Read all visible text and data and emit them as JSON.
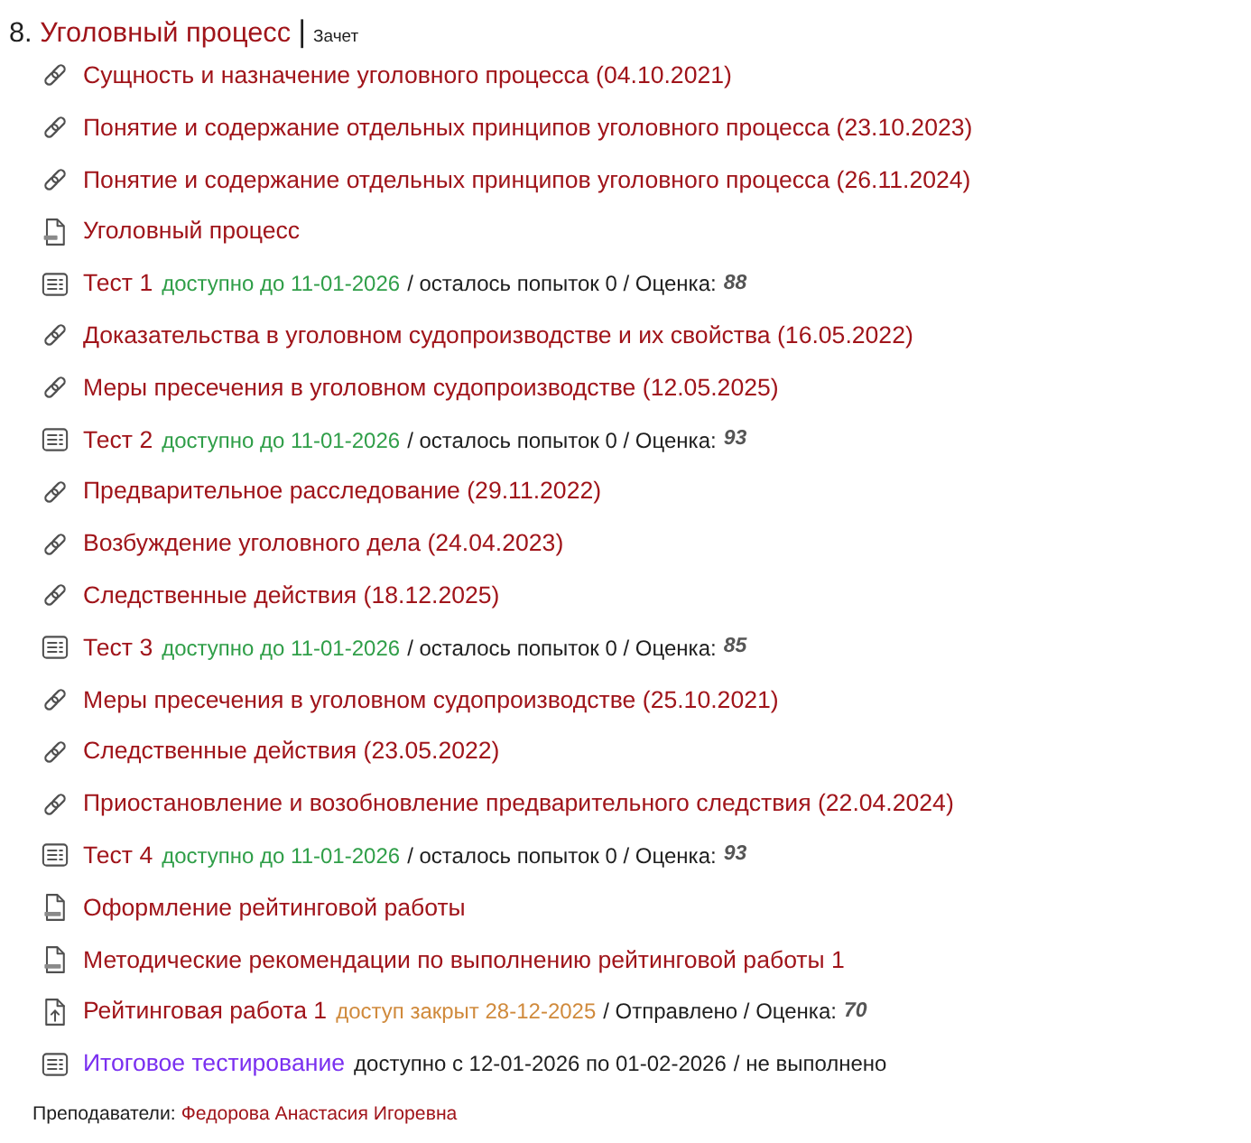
{
  "section": {
    "number": "8.",
    "title": "Уголовный процесс",
    "separator": "|",
    "tag": "Зачет"
  },
  "items": [
    {
      "kind": "link",
      "title": "Сущность и назначение уголовного процесса (04.10.2021)"
    },
    {
      "kind": "link",
      "title": "Понятие и содержание отдельных принципов уголовного процесса (23.10.2023)"
    },
    {
      "kind": "link",
      "title": "Понятие и содержание отдельных принципов уголовного процесса (26.11.2024)"
    },
    {
      "kind": "pdf",
      "title": "Уголовный процесс"
    },
    {
      "kind": "test",
      "title": "Тест 1",
      "availability": {
        "text": "доступно до 11-01-2026",
        "color": "#2f9e48"
      },
      "details": "/ осталось попыток 0 / Оценка:",
      "grade": "88"
    },
    {
      "kind": "link",
      "title": "Доказательства в уголовном судопроизводстве и их свойства (16.05.2022)"
    },
    {
      "kind": "link",
      "title": "Меры пресечения в уголовном судопроизводстве (12.05.2025)"
    },
    {
      "kind": "test",
      "title": "Тест 2",
      "availability": {
        "text": "доступно до 11-01-2026",
        "color": "#2f9e48"
      },
      "details": "/ осталось попыток 0 / Оценка:",
      "grade": "93"
    },
    {
      "kind": "link",
      "title": "Предварительное расследование (29.11.2022)"
    },
    {
      "kind": "link",
      "title": "Возбуждение уголовного дела (24.04.2023)"
    },
    {
      "kind": "link",
      "title": "Следственные действия (18.12.2025)"
    },
    {
      "kind": "test",
      "title": "Тест 3",
      "availability": {
        "text": "доступно до 11-01-2026",
        "color": "#2f9e48"
      },
      "details": "/ осталось попыток 0 / Оценка:",
      "grade": "85"
    },
    {
      "kind": "link",
      "title": "Меры пресечения в уголовном судопроизводстве (25.10.2021)"
    },
    {
      "kind": "link",
      "title": "Следственные действия (23.05.2022)"
    },
    {
      "kind": "link",
      "title": "Приостановление и возобновление предварительного следствия (22.04.2024)"
    },
    {
      "kind": "test",
      "title": "Тест 4",
      "availability": {
        "text": "доступно до 11-01-2026",
        "color": "#2f9e48"
      },
      "details": "/ осталось попыток 0 / Оценка:",
      "grade": "93"
    },
    {
      "kind": "doc",
      "title": "Оформление рейтинговой работы"
    },
    {
      "kind": "doc",
      "title": "Методические рекомендации по выполнению рейтинговой работы 1"
    },
    {
      "kind": "upload",
      "title": "Рейтинговая работа 1",
      "availability": {
        "text": "доступ закрыт 28-12-2025",
        "color": "#d08a3c"
      },
      "details": "/ Отправлено / Оценка:",
      "grade": "70"
    },
    {
      "kind": "final_test",
      "title": "Итоговое тестирование",
      "availability": {
        "text": "доступно с 12-01-2026 по 01-02-2026",
        "color": "#1e1e1e"
      },
      "details": "/ не выполнено"
    }
  ],
  "teachers": {
    "label": "Преподаватели:",
    "name": "Федорова Анастасия Игоревна"
  }
}
